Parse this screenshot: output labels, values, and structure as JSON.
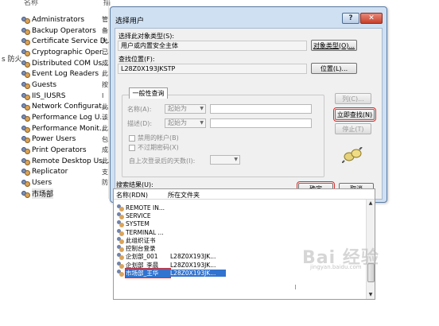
{
  "background": {
    "column_header": "名称",
    "column_header_2": "描",
    "side_label": "s 防火",
    "groups": [
      {
        "label": "Administrators",
        "desc": "管"
      },
      {
        "label": "Backup Operators",
        "desc": "备"
      },
      {
        "label": "Certificate Service D...",
        "desc": "允"
      },
      {
        "label": "Cryptographic Oper...",
        "desc": "已"
      },
      {
        "label": "Distributed COM Us...",
        "desc": "成"
      },
      {
        "label": "Event Log Readers",
        "desc": "此"
      },
      {
        "label": "Guests",
        "desc": "按"
      },
      {
        "label": "IIS_IUSRS",
        "desc": "I"
      },
      {
        "label": "Network Configurat...",
        "desc": "此"
      },
      {
        "label": "Performance Log U...",
        "desc": "该"
      },
      {
        "label": "Performance Monit...",
        "desc": "此"
      },
      {
        "label": "Power Users",
        "desc": "包"
      },
      {
        "label": "Print Operators",
        "desc": "成"
      },
      {
        "label": "Remote Desktop Us...",
        "desc": "此"
      },
      {
        "label": "Replicator",
        "desc": "支"
      },
      {
        "label": "Users",
        "desc": "防"
      },
      {
        "label": "市场部",
        "desc": ""
      }
    ]
  },
  "dialog": {
    "title": "选择用户",
    "help": "?",
    "close": "✕",
    "object_type_label": "选择此对象类型(S):",
    "object_type_value": "用户或内置安全主体",
    "object_type_button": "对象类型(O)...",
    "location_label": "查找位置(F):",
    "location_value": "L28Z0X193JKSTP",
    "location_button": "位置(L)...",
    "tab_label": "一般性查询",
    "name_label": "名称(A):",
    "name_combo": "起始为",
    "desc_label": "描述(D):",
    "desc_combo": "起始为",
    "disabled_accounts": "禁用的帐户(B)",
    "no_expire_password": "不过期密码(X)",
    "days_since_logon": "自上次登录后的天数(I):",
    "columns_button": "列(C)...",
    "find_now_button": "立即查找(N)",
    "stop_button": "停止(T)",
    "ok_button": "确定",
    "cancel_button": "取消",
    "results_label": "搜索结果(U):",
    "results_header": {
      "name": "名称(RDN)",
      "folder": "所在文件夹"
    },
    "results": [
      {
        "name": "REMOTE IN...",
        "folder": ""
      },
      {
        "name": "SERVICE",
        "folder": ""
      },
      {
        "name": "SYSTEM",
        "folder": ""
      },
      {
        "name": "TERMINAL ...",
        "folder": ""
      },
      {
        "name": "此组织证书",
        "folder": ""
      },
      {
        "name": "控制台登录",
        "folder": ""
      },
      {
        "name": "企划部_001",
        "folder": "L28Z0X193JK..."
      },
      {
        "name": "企划部_李晨",
        "folder": "L28Z0X193JK..."
      },
      {
        "name": "市场部_王华",
        "folder": "L28Z0X193JK...",
        "selected": true
      }
    ]
  },
  "watermark": {
    "logo": "Bai 经验",
    "sub": "jingyan.baidu.com"
  }
}
